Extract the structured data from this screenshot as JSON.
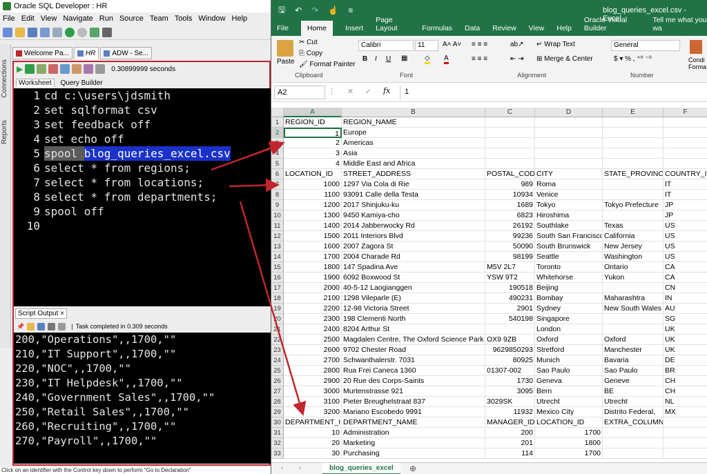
{
  "sqldev": {
    "title": "Oracle SQL Developer : HR",
    "menu": [
      "File",
      "Edit",
      "View",
      "Navigate",
      "Run",
      "Source",
      "Team",
      "Tools",
      "Window",
      "Help"
    ],
    "left_tabs": [
      "Connections",
      "Reports"
    ],
    "doc_tabs": [
      "Welcome Pa...",
      "HR",
      "ADW - Se..."
    ],
    "elapsed": "0.30899999 seconds",
    "subtabs": [
      "Worksheet",
      "Query Builder"
    ],
    "code_lines": [
      "cd c:\\users\\jdsmith",
      "set sqlformat csv",
      "set feedback off",
      "set echo off",
      "spool ",
      "select * from regions;",
      "select * from locations;",
      "select * from departments;",
      "spool off",
      ""
    ],
    "spool_file": "blog_queries_excel.csv",
    "output_tab": "Script Output",
    "task_status": "Task completed in 0.309 seconds",
    "output_lines": [
      "200,\"Operations\",,1700,\"\"",
      "210,\"IT Support\",,1700,\"\"",
      "220,\"NOC\",,1700,\"\"",
      "230,\"IT Helpdesk\",,1700,\"\"",
      "240,\"Government Sales\",,1700,\"\"",
      "250,\"Retail Sales\",,1700,\"\"",
      "260,\"Recruiting\",,1700,\"\"",
      "270,\"Payroll\",,1700,\"\""
    ],
    "status_bar": "Click on an identifier with the Control key down to perform \"Go to Declaration\""
  },
  "excel": {
    "title": "blog_queries_excel.csv  -  Excel",
    "menu": [
      "File",
      "Home",
      "Insert",
      "Page Layout",
      "Formulas",
      "Data",
      "Review",
      "View",
      "Help",
      "Oracle Visual Builder",
      "Tell me what you wa"
    ],
    "ribbon": {
      "paste": "Paste",
      "cut": "Cut",
      "copy": "Copy",
      "format_painter": "Format Painter",
      "clipboard": "Clipboard",
      "font_name": "Calibri",
      "font_size": "11",
      "font_label": "Font",
      "wrap_text": "Wrap Text",
      "merge_center": "Merge & Center",
      "alignment": "Alignment",
      "number_format": "General",
      "number_label": "Number",
      "conditional": "Condi Forma"
    },
    "name_box": "A2",
    "formula_value": "1",
    "columns": [
      "A",
      "B",
      "C",
      "D",
      "E",
      "F"
    ],
    "rows": [
      [
        "REGION_ID",
        "REGION_NAME",
        "",
        "",
        "",
        ""
      ],
      [
        "1",
        "Europe",
        "",
        "",
        "",
        ""
      ],
      [
        "2",
        "Americas",
        "",
        "",
        "",
        ""
      ],
      [
        "3",
        "Asia",
        "",
        "",
        "",
        ""
      ],
      [
        "4",
        "Middle East and Africa",
        "",
        "",
        "",
        ""
      ],
      [
        "LOCATION_ID",
        "STREET_ADDRESS",
        "POSTAL_CODE",
        "CITY",
        "STATE_PROVINCE",
        "COUNTRY_ID"
      ],
      [
        "1000",
        "1297 Via Cola di Rie",
        "989",
        "Roma",
        "",
        "IT"
      ],
      [
        "1100",
        "93091 Calle della Testa",
        "10934",
        "Venice",
        "",
        "IT"
      ],
      [
        "1200",
        "2017 Shinjuku-ku",
        "1689",
        "Tokyo",
        "Tokyo Prefecture",
        "JP"
      ],
      [
        "1300",
        "9450 Kamiya-cho",
        "6823",
        "Hiroshima",
        "",
        "JP"
      ],
      [
        "1400",
        "2014 Jabberwocky Rd",
        "26192",
        "Southlake",
        "Texas",
        "US"
      ],
      [
        "1500",
        "2011 Interiors Blvd",
        "99236",
        "South San Francisco",
        "California",
        "US"
      ],
      [
        "1600",
        "2007 Zagora St",
        "50090",
        "South Brunswick",
        "New Jersey",
        "US"
      ],
      [
        "1700",
        "2004 Charade Rd",
        "98199",
        "Seattle",
        "Washington",
        "US"
      ],
      [
        "1800",
        "147 Spadina Ave",
        "M5V 2L7",
        "Toronto",
        "Ontario",
        "CA"
      ],
      [
        "1900",
        "6092 Boxwood St",
        "YSW 9T2",
        "Whitehorse",
        "Yukon",
        "CA"
      ],
      [
        "2000",
        "40-5-12 Laogianggen",
        "190518",
        "Beijing",
        "",
        "CN"
      ],
      [
        "2100",
        "1298 Vileparle (E)",
        "490231",
        "Bombay",
        "Maharashtra",
        "IN"
      ],
      [
        "2200",
        "12-98 Victoria Street",
        "2901",
        "Sydney",
        "New South Wales",
        "AU"
      ],
      [
        "2300",
        "198 Clementi North",
        "540198",
        "Singapore",
        "",
        "SG"
      ],
      [
        "2400",
        "8204 Arthur St",
        "",
        "London",
        "",
        "UK"
      ],
      [
        "2500",
        "Magdalen Centre, The Oxford Science Park",
        "OX9 9ZB",
        "Oxford",
        "Oxford",
        "UK"
      ],
      [
        "2600",
        "9702 Chester Road",
        "9629850293",
        "Stretford",
        "Manchester",
        "UK"
      ],
      [
        "2700",
        "Schwanthalerstr. 7031",
        "80925",
        "Munich",
        "Bavaria",
        "DE"
      ],
      [
        "2800",
        "Rua Frei Caneca 1360",
        "01307-002",
        "Sao Paulo",
        "Sao Paulo",
        "BR"
      ],
      [
        "2900",
        "20 Rue des Corps-Saints",
        "1730",
        "Geneva",
        "Geneve",
        "CH"
      ],
      [
        "3000",
        "Murtenstrasse 921",
        "3095",
        "Bern",
        "BE",
        "CH"
      ],
      [
        "3100",
        "Pieter Breughelstraat 837",
        "3029SK",
        "Utrecht",
        "Utrecht",
        "NL"
      ],
      [
        "3200",
        "Mariano Escobedo 9991",
        "11932",
        "Mexico City",
        "Distrito Federal,",
        "MX"
      ],
      [
        "DEPARTMENT_ID",
        "DEPARTMENT_NAME",
        "MANAGER_ID",
        "LOCATION_ID",
        "EXTRA_COLUMN",
        ""
      ],
      [
        "10",
        "Administration",
        "200",
        "1700",
        "",
        ""
      ],
      [
        "20",
        "Marketing",
        "201",
        "1800",
        "",
        ""
      ],
      [
        "30",
        "Purchasing",
        "114",
        "1700",
        "",
        ""
      ]
    ],
    "sheet_tab": "blog_queries_excel"
  }
}
